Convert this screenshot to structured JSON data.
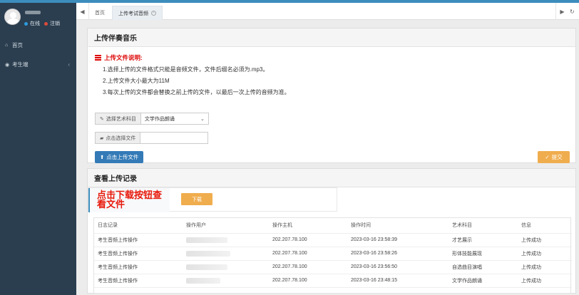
{
  "sidebar": {
    "status_online": "在线",
    "status_logout": "注销",
    "menu": [
      {
        "icon": "home-icon",
        "label": "首页"
      },
      {
        "icon": "user-circle-icon",
        "label": "考生端"
      }
    ]
  },
  "tabs": {
    "home": "首页",
    "active": "上传考试音频"
  },
  "upload_panel": {
    "title": "上传伴奏音乐",
    "notice_title": "上传文件说明:",
    "notice_lines": [
      "1.选择上传的文件格式只能是音频文件，文件后缀名必须为.mp3。",
      "2.上传文件大小最大为11M",
      "3.每次上传的文件都会替换之前上传的文件，以最后一次上传的音频为准。"
    ],
    "subject_label": "选择艺术科目",
    "subject_value": "文学作品朗诵",
    "file_label": "点击选择文件",
    "upload_button": "点击上传文件",
    "confirm_button": "提交"
  },
  "records_panel": {
    "title": "查看上传记录",
    "download_note": "点击下载按钮查看文件",
    "download_button": "下载",
    "columns": [
      "日志记录",
      "操作用户",
      "操作主机",
      "操作时间",
      "艺术科目",
      "信息"
    ],
    "rows": [
      {
        "log": "考生音频上传操作",
        "host": "202.207.78.100",
        "time": "2023-03-16 23:58:39",
        "subject": "才艺展示",
        "info": "上传成功"
      },
      {
        "log": "考生音频上传操作",
        "host": "202.207.78.100",
        "time": "2023-03-16 23:58:26",
        "subject": "形体技能展现",
        "info": "上传成功"
      },
      {
        "log": "考生音频上传操作",
        "host": "202.207.78.100",
        "time": "2023-03-16 23:56:50",
        "subject": "自选曲目演唱",
        "info": "上传成功"
      },
      {
        "log": "考生音频上传操作",
        "host": "202.207.78.100",
        "time": "2023-03-16 23:48:15",
        "subject": "文学作品朗诵",
        "info": "上传成功"
      }
    ]
  },
  "colors": {
    "sidebar_bg": "#2b3e50",
    "primary": "#337ab7",
    "warning": "#f0ad4e",
    "danger_text": "#e8190b"
  }
}
